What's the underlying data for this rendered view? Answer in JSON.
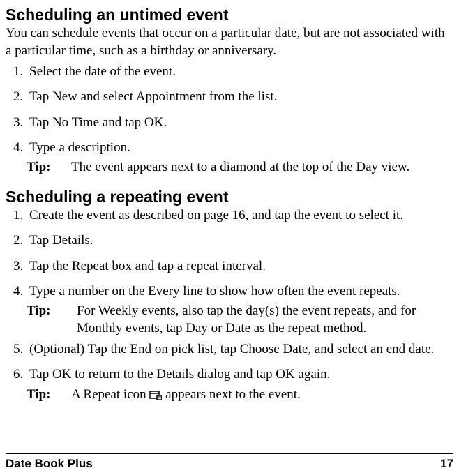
{
  "section1": {
    "heading": "Scheduling an untimed event",
    "intro": "You can schedule events that occur on a particular date, but are not associated with a particular time, such as a birthday or anniversary.",
    "steps": [
      "Select the date of the event.",
      "Tap New and select Appointment from the list.",
      "Tap No Time and tap OK.",
      "Type a description."
    ],
    "tip_label": "Tip:",
    "tip": "The event appears next to a diamond at the top of the Day view."
  },
  "section2": {
    "heading": "Scheduling a repeating event",
    "steps": [
      "Create the event as described on page 16, and tap the event to select it.",
      "Tap Details.",
      "Tap the Repeat box and tap a repeat interval.",
      "Type a number on the Every line to show how often the event repeats."
    ],
    "tip_label": "Tip:",
    "tip": "For Weekly events, also tap the day(s) the event repeats, and for Monthly events, tap Day or Date as the repeat method.",
    "steps2": [
      "(Optional) Tap the End on pick list, tap Choose Date, and select an end date.",
      "Tap OK to return to the Details dialog and tap OK again."
    ],
    "tip2_label": "Tip:",
    "tip2_before": "A Repeat icon ",
    "tip2_after": " appears next to the event."
  },
  "footer": {
    "left": "Date Book Plus",
    "right": "17"
  }
}
